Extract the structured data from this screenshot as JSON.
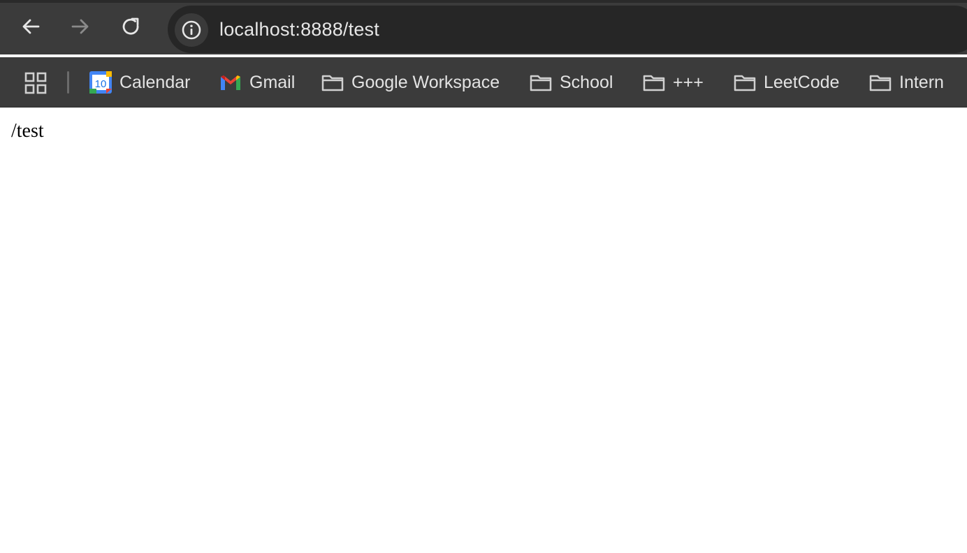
{
  "browser": {
    "address": "localhost:8888/test"
  },
  "bookmarks": [
    {
      "label": "Calendar",
      "icon": "calendar-icon",
      "badge": "10"
    },
    {
      "label": "Gmail",
      "icon": "gmail-icon"
    },
    {
      "label": "Google Workspace",
      "icon": "folder-icon"
    },
    {
      "label": "School",
      "icon": "folder-icon"
    },
    {
      "label": "+++",
      "icon": "folder-icon"
    },
    {
      "label": "LeetCode",
      "icon": "folder-icon"
    },
    {
      "label": "Intern",
      "icon": "folder-icon"
    }
  ],
  "page": {
    "body_text": "/test"
  },
  "colors": {
    "toolbar": "#3b3b3b",
    "omnibox": "#262626",
    "text_light": "#e6e6e6"
  }
}
